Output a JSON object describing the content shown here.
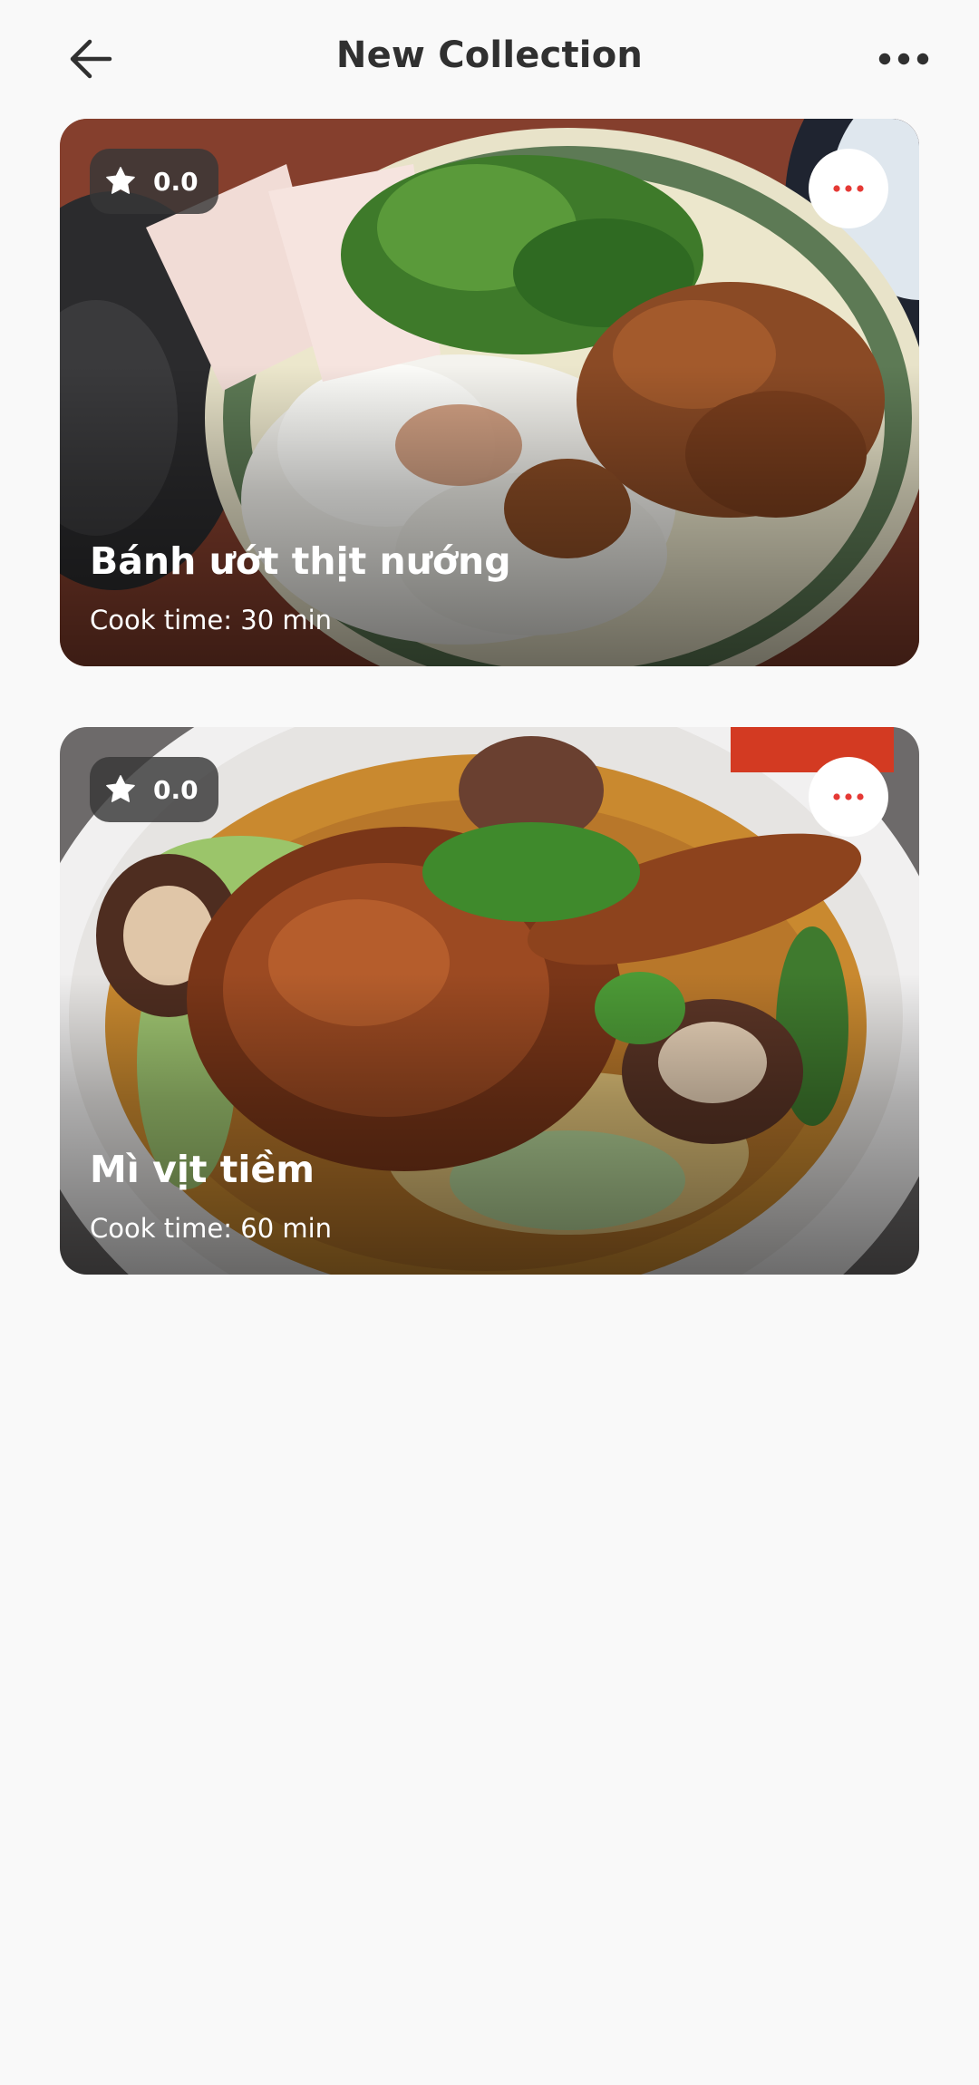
{
  "header": {
    "title": "New Collection",
    "back_icon": "arrow-left-icon",
    "menu_icon": "more-horizontal-icon"
  },
  "theme": {
    "accent": "#e53935",
    "text": "#303030",
    "background": "#f9f9f9"
  },
  "recipes": [
    {
      "name": "Bánh ướt thịt nướng",
      "rating": "0.0",
      "cook_time": "Cook time: 30 min",
      "rating_icon": "star-icon",
      "menu_icon": "more-horizontal-icon"
    },
    {
      "name": "Mì vịt tiềm",
      "rating": "0.0",
      "cook_time": "Cook time: 60 min",
      "rating_icon": "star-icon",
      "menu_icon": "more-horizontal-icon"
    }
  ]
}
